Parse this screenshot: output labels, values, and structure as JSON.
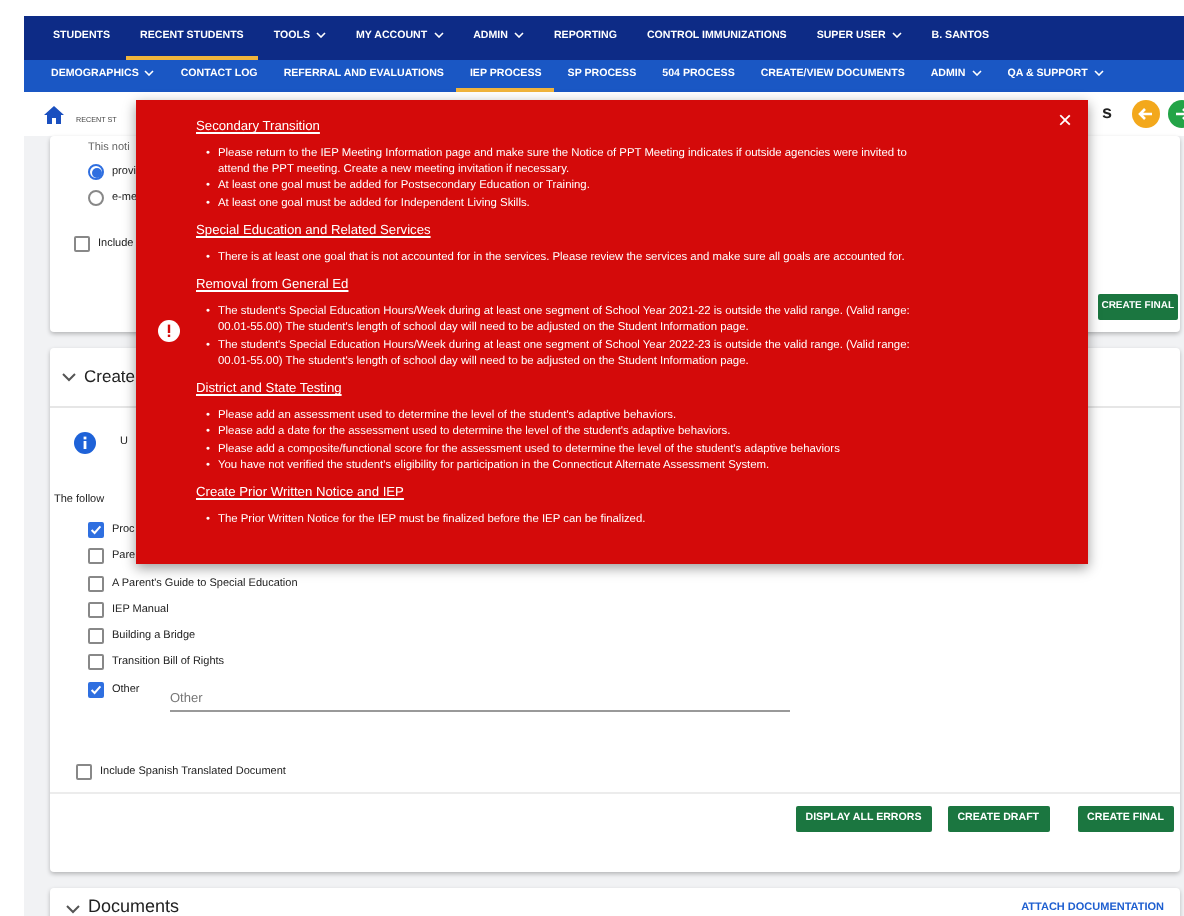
{
  "top_nav": [
    {
      "label": "STUDENTS",
      "dropdown": false,
      "selected": false
    },
    {
      "label": "RECENT STUDENTS",
      "dropdown": false,
      "selected": true
    },
    {
      "label": "TOOLS",
      "dropdown": true,
      "selected": false
    },
    {
      "label": "MY ACCOUNT",
      "dropdown": true,
      "selected": false
    },
    {
      "label": "ADMIN",
      "dropdown": true,
      "selected": false
    },
    {
      "label": "REPORTING",
      "dropdown": false,
      "selected": false
    },
    {
      "label": "CONTROL IMMUNIZATIONS",
      "dropdown": false,
      "selected": false
    },
    {
      "label": "SUPER USER",
      "dropdown": true,
      "selected": false
    },
    {
      "label": "B. SANTOS",
      "dropdown": false,
      "selected": false
    }
  ],
  "sub_nav": [
    {
      "label": "DEMOGRAPHICS",
      "dropdown": true,
      "selected": false
    },
    {
      "label": "CONTACT LOG",
      "dropdown": false,
      "selected": false
    },
    {
      "label": "REFERRAL AND EVALUATIONS",
      "dropdown": false,
      "selected": false
    },
    {
      "label": "IEP PROCESS",
      "dropdown": false,
      "selected": true
    },
    {
      "label": "SP PROCESS",
      "dropdown": false,
      "selected": false
    },
    {
      "label": "504 PROCESS",
      "dropdown": false,
      "selected": false
    },
    {
      "label": "CREATE/VIEW DOCUMENTS",
      "dropdown": false,
      "selected": false
    },
    {
      "label": "ADMIN",
      "dropdown": true,
      "selected": false
    },
    {
      "label": "QA & SUPPORT",
      "dropdown": true,
      "selected": false
    }
  ],
  "breadcrumb": {
    "line_2": "RECENT ST"
  },
  "title_fragment": "s",
  "notice_card": {
    "text": "This noti",
    "radios": [
      {
        "label": "provi",
        "selected": true
      },
      {
        "label": "e-me",
        "selected": false
      }
    ],
    "checkbox": {
      "label": "Include",
      "checked": false
    },
    "button": "CREATE FINAL"
  },
  "create_card": {
    "title": "Create",
    "info_text": "U",
    "intro": "The follow",
    "documents": [
      {
        "label": "Proc",
        "checked": true
      },
      {
        "label": "Pare",
        "checked": false
      },
      {
        "label": "A Parent's Guide to Special Education",
        "checked": false
      },
      {
        "label": "IEP Manual",
        "checked": false
      },
      {
        "label": "Building a Bridge",
        "checked": false
      },
      {
        "label": "Transition Bill of Rights",
        "checked": false
      },
      {
        "label": "Other",
        "checked": true
      }
    ],
    "other_field": {
      "placeholder": "Other"
    },
    "spanish": {
      "label": "Include Spanish Translated Document",
      "checked": false
    },
    "buttons": [
      "DISPLAY ALL ERRORS",
      "CREATE DRAFT",
      "CREATE FINAL"
    ]
  },
  "documents_card": {
    "title": "Documents",
    "link": "ATTACH DOCUMENTATION"
  },
  "error_dialog": {
    "close": "×",
    "bullet": "•",
    "sections": [
      {
        "title": "Secondary Transition",
        "items": [
          "Please return to the IEP Meeting Information page and make sure the Notice of PPT Meeting indicates if outside agencies were invited to attend the PPT meeting. Create a new meeting invitation if necessary.",
          "At least one goal must be added for Postsecondary Education or Training.",
          "At least one goal must be added for Independent Living Skills."
        ]
      },
      {
        "title": "Special Education and Related Services",
        "items": [
          "There is at least one goal that is not accounted for in the services. Please review the services and make sure all goals are accounted for."
        ]
      },
      {
        "title": "Removal from General Ed",
        "items": [
          "The student's Special Education Hours/Week during at least one segment of School Year 2021-22 is outside the valid range. (Valid range: 00.01-55.00) The student's length of school day will need to be adjusted on the Student Information page.",
          "The student's Special Education Hours/Week during at least one segment of School Year 2022-23 is outside the valid range. (Valid range: 00.01-55.00) The student's length of school day will need to be adjusted on the Student Information page."
        ]
      },
      {
        "title": "District and State Testing",
        "items": [
          "Please add an assessment used to determine the level of the student's adaptive behaviors.",
          "Please add a date for the assessment used to determine the level of the student's adaptive behaviors.",
          "Please add a composite/functional score for the assessment used to determine the level of the student's adaptive behaviors",
          "You have not verified the student's eligibility for participation in the Connecticut Alternate Assessment System."
        ]
      },
      {
        "title": "Create Prior Written Notice and IEP",
        "items": [
          "The Prior Written Notice for the IEP must be finalized before the IEP can be finalized."
        ]
      }
    ]
  }
}
